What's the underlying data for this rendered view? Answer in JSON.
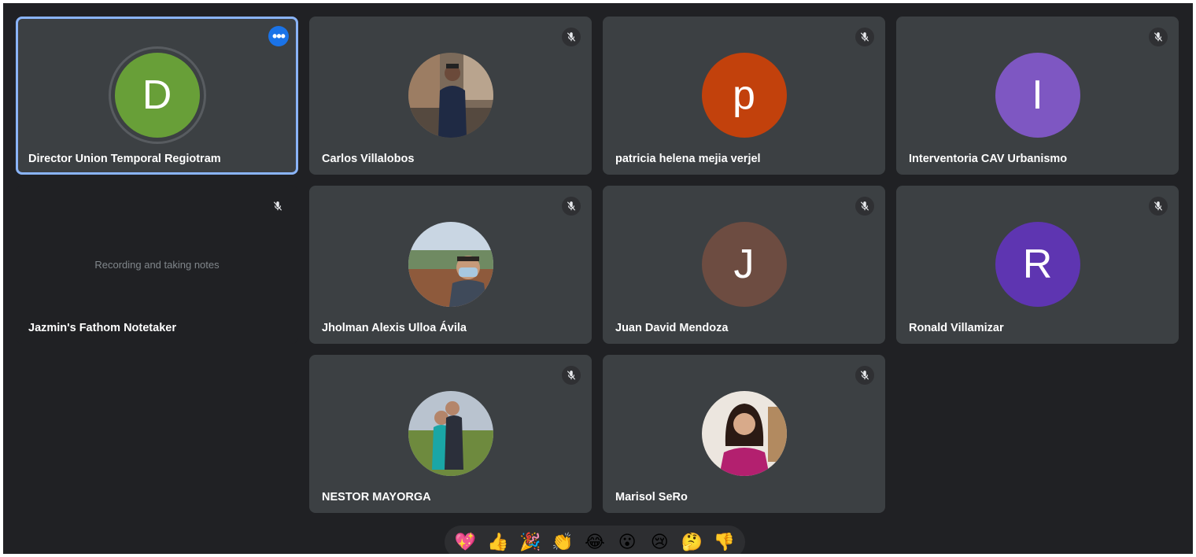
{
  "tiles": [
    {
      "name": "Director Union Temporal Regiotram",
      "initial": "D",
      "avatar_color": "#689f38",
      "active": true,
      "more_button": true
    },
    {
      "name": "Carlos Villalobos",
      "avatar": "photo-man-jacket",
      "muted": true
    },
    {
      "name": "patricia helena mejia verjel",
      "initial": "p",
      "avatar_color": "#c2410c",
      "muted": true
    },
    {
      "name": "Interventoria CAV Urbanismo",
      "initial": "I",
      "avatar_color": "#7e57c2",
      "muted": true
    },
    {
      "name": "Jazmin's Fathom Notetaker",
      "status": "Recording and taking notes",
      "muted": true
    },
    {
      "name": "Jholman Alexis Ulloa Ávila",
      "avatar": "photo-man-mask",
      "muted": true
    },
    {
      "name": "Juan David Mendoza",
      "initial": "J",
      "avatar_color": "#6d4c41",
      "muted": true
    },
    {
      "name": "Ronald Villamizar",
      "initial": "R",
      "avatar_color": "#5e35b1",
      "muted": true
    },
    {
      "name": "NESTOR MAYORGA",
      "avatar": "photo-couple-field",
      "muted": true
    },
    {
      "name": "Marisol SeRo",
      "avatar": "photo-woman-portrait",
      "muted": true
    }
  ],
  "reactions": [
    "💖",
    "👍",
    "🎉",
    "👏",
    "😂",
    "😮",
    "😢",
    "🤔",
    "👎"
  ],
  "icons": {
    "muted": "mic-off-icon",
    "more": "more-options-icon"
  },
  "colors": {
    "stage_bg": "#202124",
    "tile_bg": "#3c4043",
    "active_outline": "#8ab4f8",
    "more_button": "#1a73e8"
  }
}
